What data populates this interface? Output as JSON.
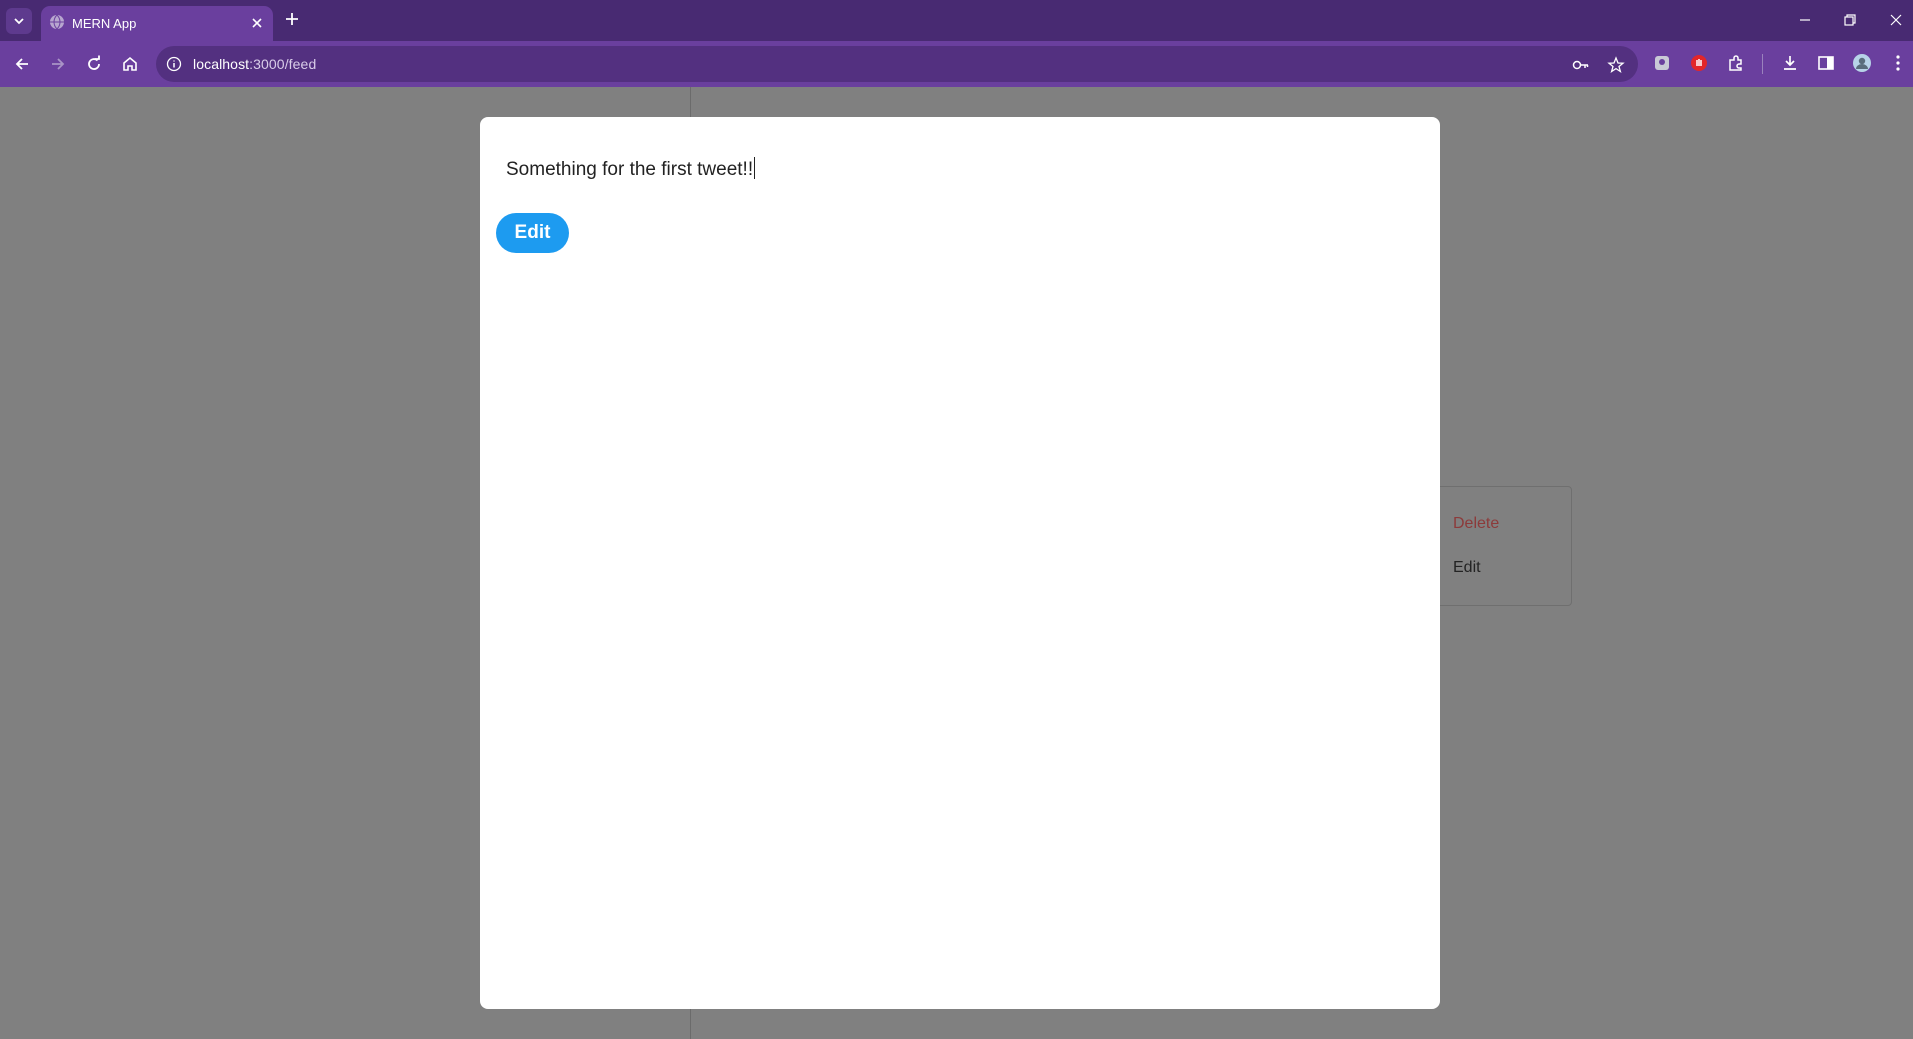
{
  "browser": {
    "tab_title": "MERN App",
    "url_host": "localhost",
    "url_path": ":3000/feed",
    "accent_color": "#6a3f9e",
    "tabbar_color": "#482a72"
  },
  "modal": {
    "tweet_text": "Something for the first tweet!!",
    "edit_button_label": "Edit",
    "edit_button_color": "#1d9bf0"
  },
  "context_menu": {
    "delete_label": "Delete",
    "edit_label": "Edit"
  }
}
